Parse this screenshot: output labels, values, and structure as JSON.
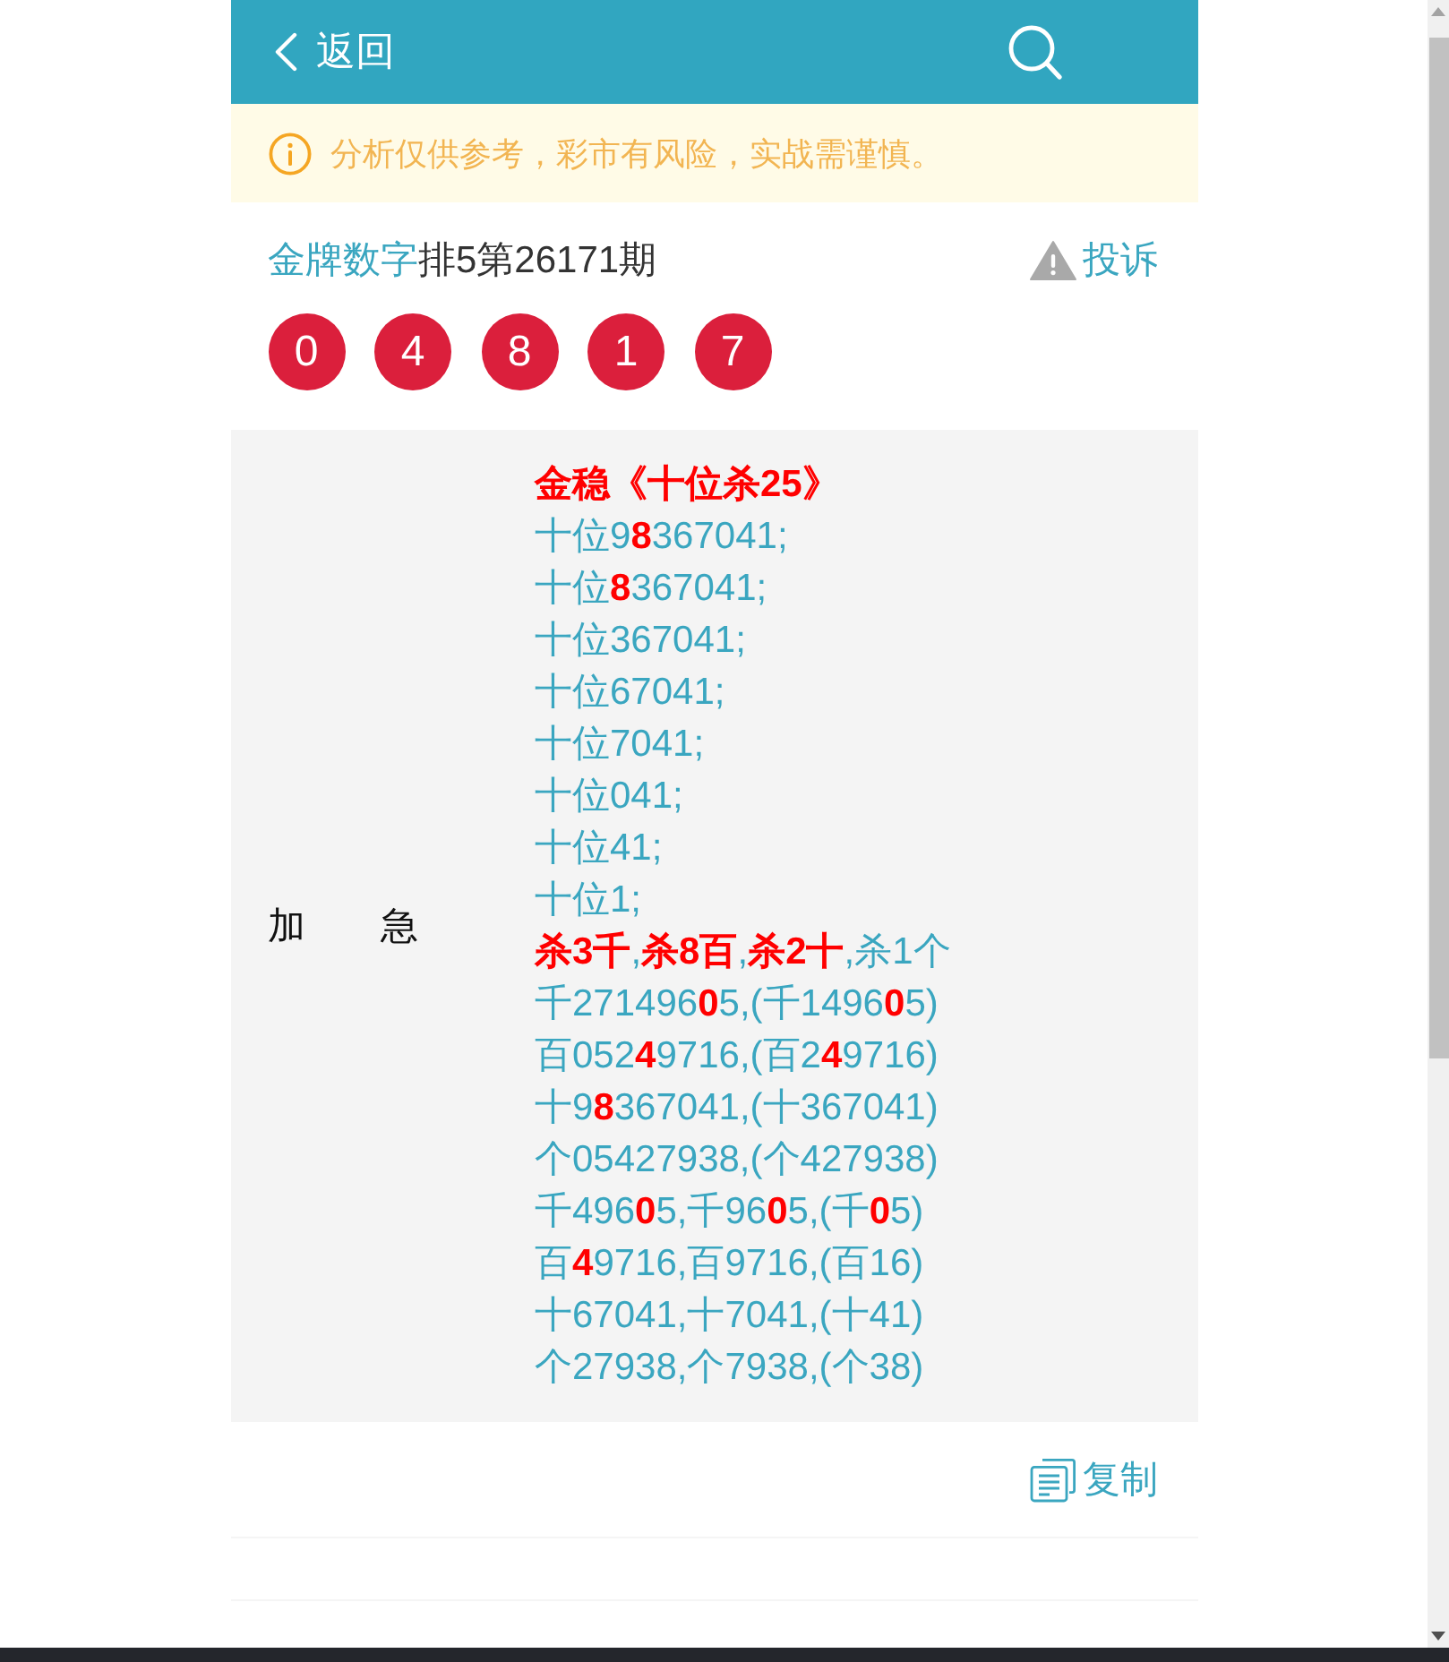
{
  "header": {
    "back_label": "返回"
  },
  "notice": {
    "text": "分析仅供参考，彩市有风险，实战需谨慎。"
  },
  "post": {
    "author": "金牌数字",
    "issue": "排5第26171期",
    "report_label": "投诉",
    "numbers": [
      "0",
      "4",
      "8",
      "1",
      "7"
    ]
  },
  "panel": {
    "label": "加　　急",
    "lines": [
      {
        "kind": "heading",
        "text": "金稳《十位杀25》"
      },
      {
        "kind": "plain",
        "text": "十位9**8**367041;"
      },
      {
        "kind": "plain",
        "text": "十位**8**367041;"
      },
      {
        "kind": "plain",
        "text": "十位367041;"
      },
      {
        "kind": "plain",
        "text": "十位67041;"
      },
      {
        "kind": "plain",
        "text": "十位7041;"
      },
      {
        "kind": "plain",
        "text": "十位041;"
      },
      {
        "kind": "plain",
        "text": "十位41;"
      },
      {
        "kind": "plain",
        "text": "十位1;"
      },
      {
        "kind": "plain",
        "text": "**杀3千**,**杀8百**,**杀2十**,杀1个"
      },
      {
        "kind": "plain",
        "text": "千271496**0**5,(千1496**0**5)"
      },
      {
        "kind": "plain",
        "text": "百052**4**9716,(百2**4**9716)"
      },
      {
        "kind": "plain",
        "text": "十9**8**367041,(十367041)"
      },
      {
        "kind": "plain",
        "text": "个05427938,(个427938)"
      },
      {
        "kind": "plain",
        "text": "千496**0**5,千96**0**5,(千**0**5)"
      },
      {
        "kind": "plain",
        "text": "百**4**9716,百9716,(百16)"
      },
      {
        "kind": "plain",
        "text": "十67041,十7041,(十41)"
      },
      {
        "kind": "plain",
        "text": "个27938,个7938,(个38)"
      }
    ]
  },
  "copy": {
    "label": "复制"
  }
}
